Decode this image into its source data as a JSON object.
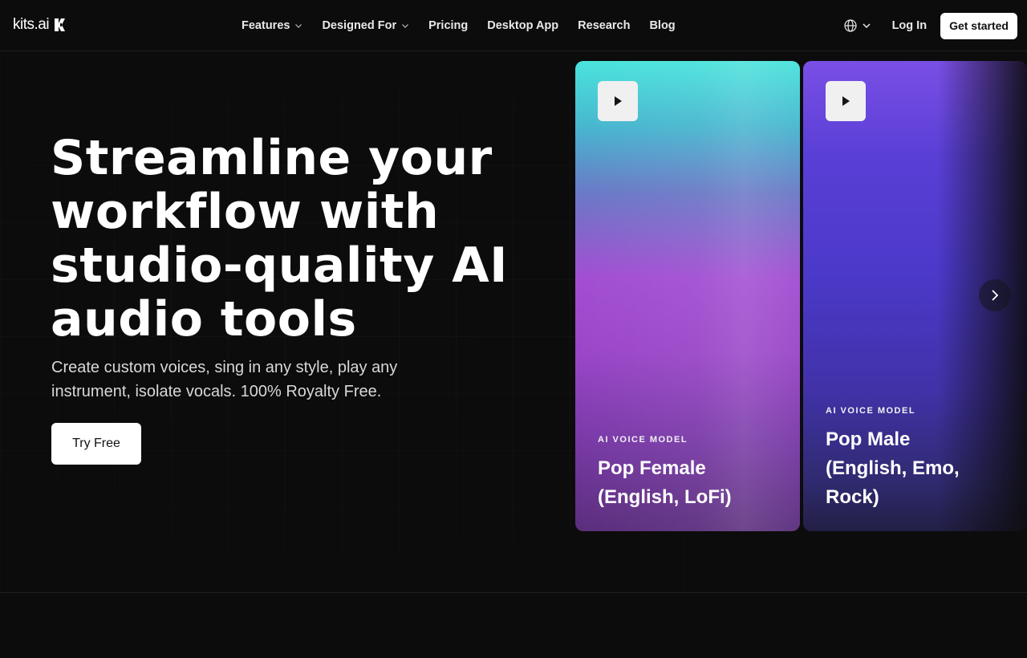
{
  "nav": {
    "logo_text": "kits.ai",
    "links": [
      {
        "label": "Features",
        "dropdown": true
      },
      {
        "label": "Designed For",
        "dropdown": true
      },
      {
        "label": "Pricing"
      },
      {
        "label": "Desktop App"
      },
      {
        "label": "Research"
      },
      {
        "label": "Blog"
      }
    ],
    "language_icon": "globe-icon",
    "login_label": "Log In",
    "cta_label": "Get started"
  },
  "hero": {
    "title_lines": [
      "Streamline your",
      "workflow with",
      "studio-quality AI",
      "audio tools"
    ],
    "subtitle_lines": [
      "Create custom voices, sing in any style, play any",
      "instrument, isolate vocals. 100% Royalty Free."
    ],
    "button_label": "Try Free"
  },
  "cards": [
    {
      "tag": "AI VOICE MODEL",
      "title_lines": [
        "Pop Female",
        "(English, LoFi)"
      ],
      "accent": "#a24ed2"
    },
    {
      "tag": "AI VOICE MODEL",
      "title_lines": [
        "Pop Male",
        "(English, Emo,",
        "Rock)"
      ],
      "accent": "#4b39c9"
    }
  ],
  "colors": {
    "background": "#0c0c0c",
    "button_bg": "#ffffff",
    "button_text": "#111111"
  }
}
